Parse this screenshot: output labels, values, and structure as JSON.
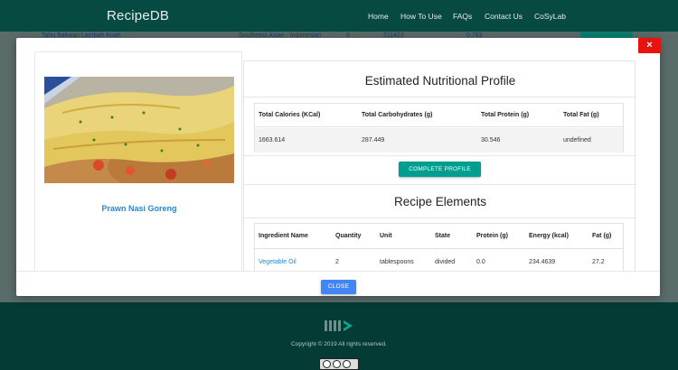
{
  "navbar": {
    "brand": "RecipeDB",
    "links": [
      "Home",
      "How To Use",
      "FAQs",
      "Contact Us",
      "CoSyLab"
    ]
  },
  "background_row": {
    "recipe": "Tahu Bakwan Lambah Kuah",
    "region": "Southeast Asian - Indonesian",
    "num1": "6",
    "num2": "211422",
    "num3": "0.763"
  },
  "modal": {
    "close_x": "×",
    "recipe_title": "Prawn Nasi Goreng",
    "nutrition": {
      "title": "Estimated Nutritional Profile",
      "headers": [
        "Total Calories (KCal)",
        "Total Carbohydrates (g)",
        "Total Protein (g)",
        "Total Fat (g)"
      ],
      "values": [
        "1663.614",
        "287.449",
        "30.546",
        "undefined"
      ],
      "button": "COMPLETE PROFILE"
    },
    "ingredients": {
      "title": "Recipe Elements",
      "headers": [
        "Ingredient Name",
        "Quantity",
        "Unit",
        "State",
        "Protein (g)",
        "Energy (kcal)",
        "Fat (g)"
      ],
      "rows": [
        [
          "Vegetable Oil",
          "2",
          "tablespoons",
          "divided",
          "0.0",
          "234.4639",
          "27.2"
        ]
      ]
    },
    "footer_button": "CLOSE"
  },
  "footer": {
    "copyright": "Copyright © 2019   All rights reserved."
  },
  "colors": {
    "navbar": "#064a42",
    "footer": "#043b35",
    "teal_button": "#009e8f",
    "blue_button": "#4285f4",
    "close_red": "#e8120f",
    "link_blue": "#1e88d8"
  }
}
